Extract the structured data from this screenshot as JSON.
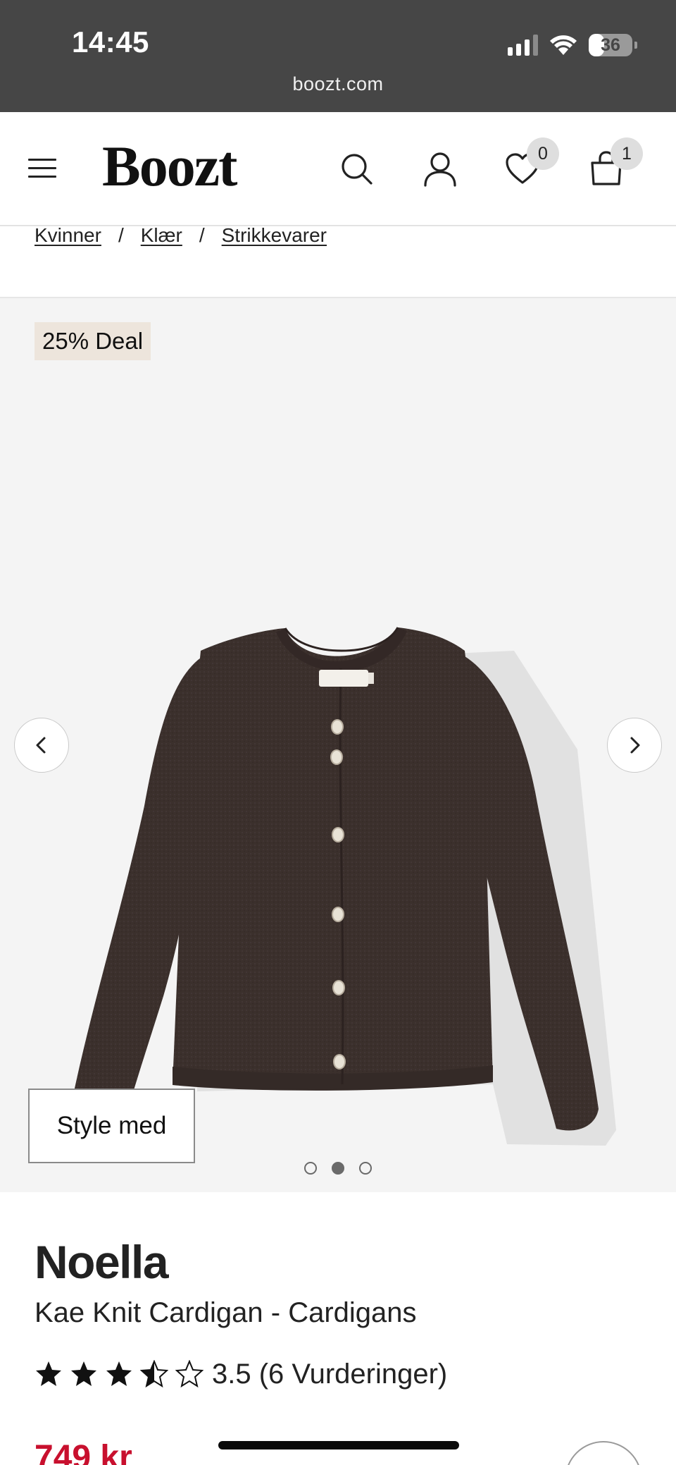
{
  "status_bar": {
    "time": "14:45",
    "battery": "36",
    "battery_level": 0.36
  },
  "browser": {
    "url": "boozt.com"
  },
  "header": {
    "logo": "Boozt",
    "wishlist_count": "0",
    "cart_count": "1"
  },
  "breadcrumb": [
    {
      "label": "Kvinner"
    },
    {
      "label": "Klær"
    },
    {
      "label": "Strikkevarer"
    }
  ],
  "breadcrumb_separator": "/",
  "gallery": {
    "deal_badge": "25% Deal",
    "style_button": "Style med",
    "image_count": 3,
    "active_image": 2
  },
  "product": {
    "brand": "Noella",
    "name": "Kae Knit Cardigan - Cardigans",
    "rating": 3.5,
    "rating_text": "3.5 (6 Vurderinger)",
    "price": "749 kr"
  },
  "colors": {
    "status_bar": "#464646",
    "price_red": "#c8102e",
    "deal_badge_bg": "#ede5dc",
    "gallery_bg": "#f4f4f4",
    "cardigan": "#3b302c"
  }
}
